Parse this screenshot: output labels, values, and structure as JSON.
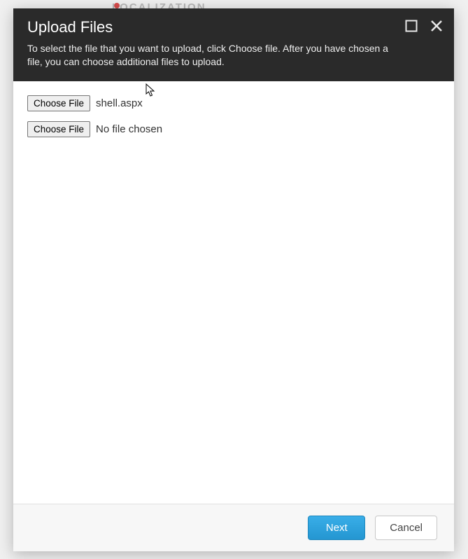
{
  "background": {
    "hint_text": "LOCALIZATION"
  },
  "modal": {
    "title": "Upload Files",
    "subtitle": "To select the file that you want to upload, click Choose file. After you have chosen a file, you can choose additional files to upload.",
    "file_inputs": [
      {
        "button_label": "Choose File",
        "file_name": "shell.aspx"
      },
      {
        "button_label": "Choose File",
        "file_name": "No file chosen"
      }
    ],
    "footer": {
      "primary_label": "Next",
      "secondary_label": "Cancel"
    }
  }
}
